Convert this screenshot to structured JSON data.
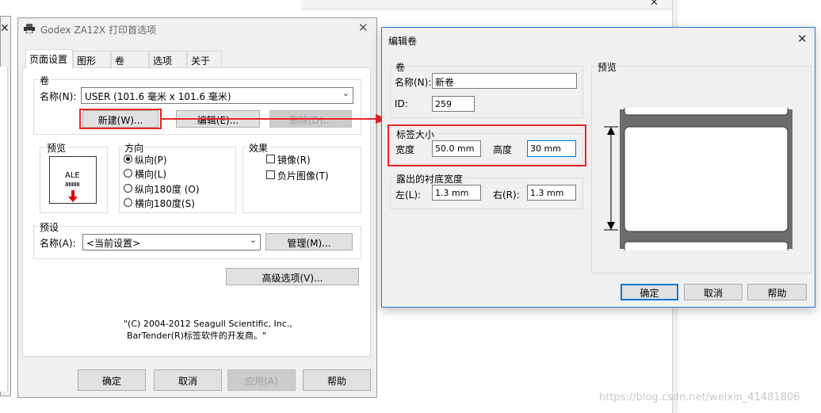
{
  "left_dialog": {
    "title": "Godex ZA12X 打印首选项",
    "tabs": [
      "页面设置",
      "图形",
      "卷",
      "选项",
      "关于"
    ],
    "stock_group": {
      "title": "卷",
      "name_label": "名称(N):",
      "name_value": "USER (101.6 毫米 x 101.6 毫米)",
      "new_button": "新建(W)...",
      "edit_button": "编辑(E)...",
      "delete_button": "删除(D)..."
    },
    "preview_group": {
      "title": "预览",
      "sample_text": "ALE"
    },
    "orientation_group": {
      "title": "方向",
      "options": [
        "纵向(P)",
        "横向(L)",
        "纵向180度 (O)",
        "横向180度(S)"
      ],
      "selected": "纵向(P)"
    },
    "effects_group": {
      "title": "效果",
      "mirror": "镜像(R)",
      "negative": "负片图像(T)"
    },
    "preset_group": {
      "title": "预设",
      "name_label": "名称(A):",
      "name_value": "<当前设置>",
      "manage_button": "管理(M)..."
    },
    "advanced_button": "高级选项(V)...",
    "copyright_line1": "\"(C) 2004-2012 Seagull Scientific, Inc.,",
    "copyright_line2": "BarTender(R)标签软件的开发商。\"",
    "buttons": {
      "ok": "确定",
      "cancel": "取消",
      "apply": "应用(A)",
      "help": "帮助"
    }
  },
  "right_dialog": {
    "title": "编辑卷",
    "stock_group": {
      "title": "卷",
      "name_label": "名称(N):",
      "name_value": "新卷",
      "id_label": "ID:",
      "id_value": "259"
    },
    "label_size_group": {
      "title": "标签大小",
      "width_label": "宽度",
      "width_value": "50.0 mm",
      "height_label": "高度",
      "height_value": "30 mm"
    },
    "backing_group": {
      "title": "露出的衬底宽度",
      "left_label": "左(L):",
      "left_value": "1.3 mm",
      "right_label": "右(R):",
      "right_value": "1.3 mm"
    },
    "preview_title": "预览",
    "buttons": {
      "ok": "确定",
      "cancel": "取消",
      "help": "帮助"
    }
  },
  "watermark": "https://blog.csdn.net/weixin_41481806",
  "colors": {
    "highlight_red": "#e8262a",
    "accent_blue": "#0078d7"
  }
}
